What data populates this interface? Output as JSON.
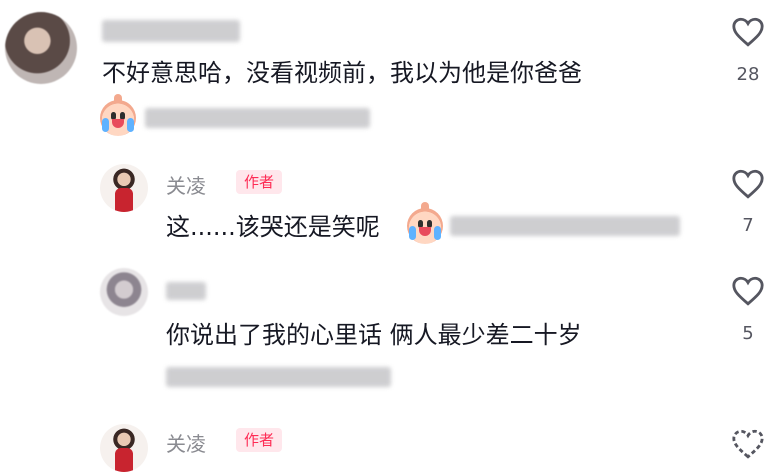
{
  "comment1": {
    "text": "不好意思哈，没看视频前，我以为他是你爸爸",
    "like_count": "28"
  },
  "reply1": {
    "author_name": "关凌",
    "badge": "作者",
    "text": "这......该哭还是笑呢",
    "like_count": "7"
  },
  "reply2": {
    "text": "你说出了我的心里话 俩人最少差二十岁",
    "like_count": "5"
  },
  "reply3": {
    "author_name": "关凌",
    "badge": "作者"
  },
  "icons": {
    "like": "heart-outline-icon",
    "emoji": "crying-laughing-emoji-icon"
  },
  "colors": {
    "badge_text": "#fe2c55",
    "badge_bg": "#ffe7ec",
    "meta_gray": "#8a8b91"
  }
}
